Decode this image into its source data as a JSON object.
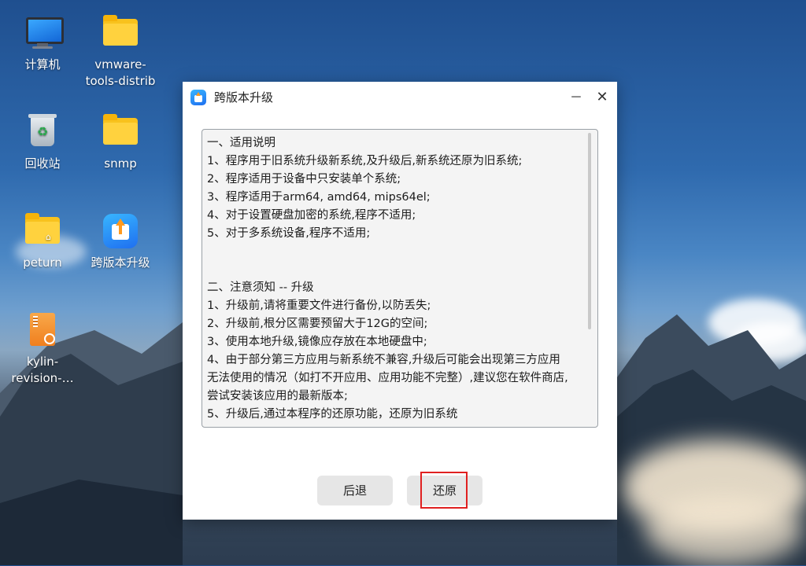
{
  "desktop": {
    "icons": [
      {
        "label": "计算机",
        "icon": "computer-icon"
      },
      {
        "label": "vmware-\ntools-distrib",
        "icon": "folder-icon"
      },
      {
        "label": "回收站",
        "icon": "trash-icon"
      },
      {
        "label": "snmp",
        "icon": "folder-icon"
      },
      {
        "label": "peturn",
        "icon": "home-folder-icon"
      },
      {
        "label": "跨版本升级",
        "icon": "upgrade-app-icon"
      },
      {
        "label": "kylin-\nrevision-…",
        "icon": "package-icon"
      }
    ]
  },
  "dialog": {
    "title": "跨版本升级",
    "minimize_label": "－",
    "close_label": "✕",
    "content_lines": [
      "一、适用说明",
      "1、程序用于旧系统升级新系统,及升级后,新系统还原为旧系统;",
      "2、程序适用于设备中只安装单个系统;",
      "3、程序适用于arm64, amd64, mips64el;",
      "4、对于设置硬盘加密的系统,程序不适用;",
      "5、对于多系统设备,程序不适用;",
      "",
      "",
      "二、注意须知 -- 升级",
      "1、升级前,请将重要文件进行备份,以防丢失;",
      "2、升级前,根分区需要预留大于12G的空间;",
      "3、使用本地升级,镜像应存放在本地硬盘中;",
      "4、由于部分第三方应用与新系统不兼容,升级后可能会出现第三方应用",
      "无法使用的情况（如打不开应用、应用功能不完整）,建议您在软件商店,",
      "尝试安装该应用的最新版本;",
      "5、升级后,通过本程序的还原功能，还原为旧系统"
    ],
    "back_button": "后退",
    "restore_button": "还原"
  },
  "colors": {
    "highlight": "#e02020",
    "app_accent": "#1f6ff0"
  }
}
